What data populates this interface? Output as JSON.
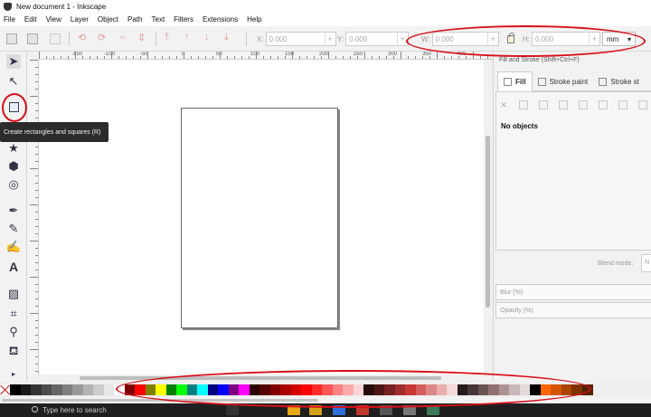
{
  "window": {
    "title": "New document 1 - Inkscape"
  },
  "menu": [
    "File",
    "Edit",
    "View",
    "Layer",
    "Object",
    "Path",
    "Text",
    "Filters",
    "Extensions",
    "Help"
  ],
  "toolbar": {
    "x_label": "X:",
    "x_value": "0.000",
    "y_label": "Y:",
    "y_value": "0.000",
    "w_label": "W:",
    "w_value": "0.000",
    "h_label": "H:",
    "h_value": "0.000",
    "units": "mm"
  },
  "ruler_top": [
    "-150",
    "-100",
    "-50",
    "0",
    "50",
    "100",
    "150",
    "200",
    "250",
    "300",
    "350",
    "400"
  ],
  "tooltip": "Create rectangles and squares (R)",
  "panel": {
    "title": "Fill and Stroke (Shift+Ctrl+F)",
    "tabs": [
      "Fill",
      "Stroke paint",
      "Stroke st"
    ],
    "no_objects": "No objects",
    "blend_label": "Blend mode:",
    "blend_value": "N",
    "blur_label": "Blur (%)",
    "opacity_label": "Opacity (%)"
  },
  "palette": {
    "colors": [
      "#000000",
      "#1a1a1a",
      "#333333",
      "#4d4d4d",
      "#666666",
      "#808080",
      "#999999",
      "#b3b3b3",
      "#cccccc",
      "#e6e6e6",
      "#ffffff",
      "#800000",
      "#ff0000",
      "#808000",
      "#ffff00",
      "#008000",
      "#00ff00",
      "#008080",
      "#00ffff",
      "#000080",
      "#0000ff",
      "#800080",
      "#ff00ff",
      "#2b0000",
      "#550000",
      "#800000",
      "#aa0000",
      "#d40000",
      "#ff0000",
      "#ff2a2a",
      "#ff5555",
      "#ff8080",
      "#ffaaaa",
      "#ffd5d5",
      "#280b0b",
      "#501616",
      "#782121",
      "#a02c2c",
      "#c83737",
      "#d35f5f",
      "#de8787",
      "#e9afaf",
      "#f4d7d7",
      "#241c1c",
      "#483737",
      "#6c5353",
      "#916f6f",
      "#ac9393",
      "#c8b7b7",
      "#e3dbdb",
      "#000000",
      "#ff6600",
      "#d45500",
      "#aa4400",
      "#803300",
      "#552200"
    ]
  },
  "taskbar": {
    "search_placeholder": "Type here to search"
  },
  "annotation_color": "#d8101a"
}
